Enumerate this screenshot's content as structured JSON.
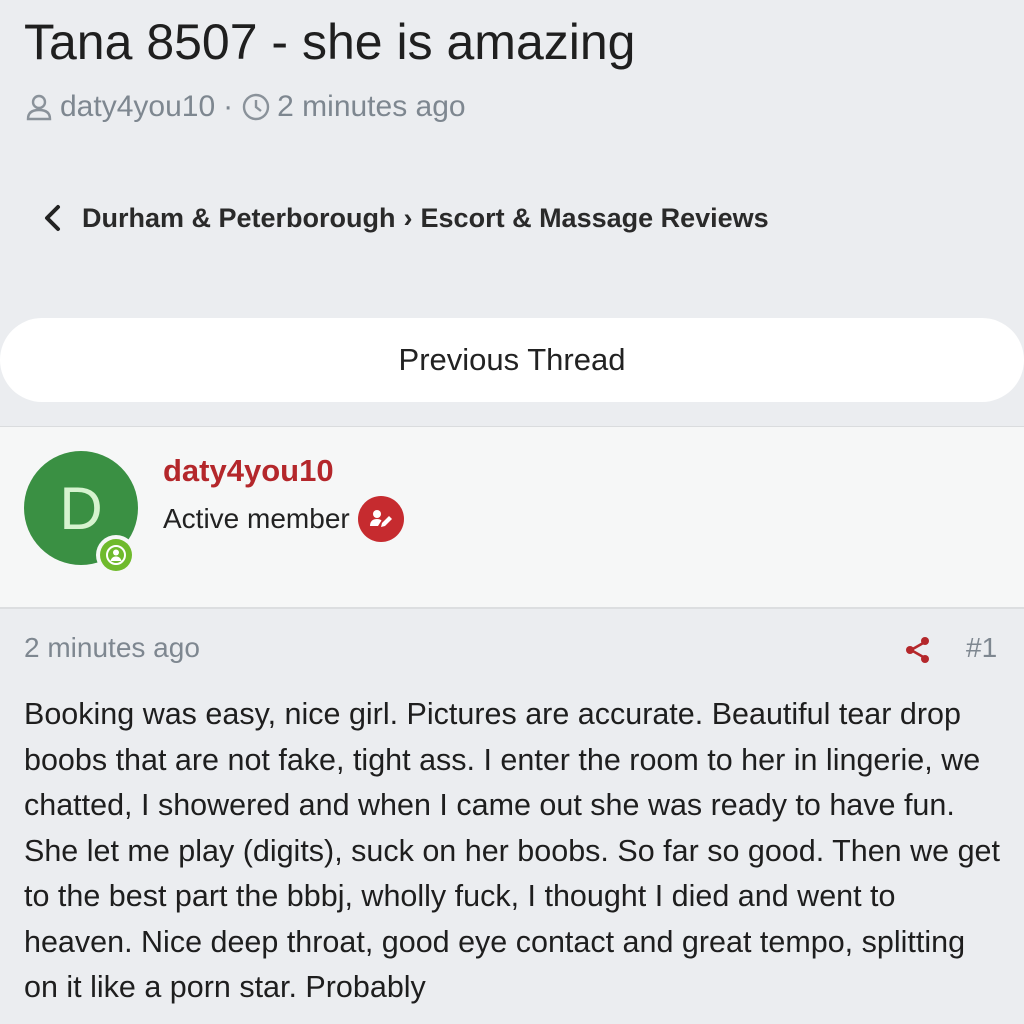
{
  "thread": {
    "title": "Tana 8507 - she is amazing",
    "author": "daty4you10",
    "separator": "·",
    "time": "2 minutes ago"
  },
  "breadcrumb": {
    "parent": "Durham & Peterborough",
    "separator": "›",
    "current": "Escort & Massage Reviews"
  },
  "navigation": {
    "previous_thread_label": "Previous Thread"
  },
  "post": {
    "avatar_letter": "D",
    "author": "daty4you10",
    "role": "Active member",
    "time": "2 minutes ago",
    "number": "#1",
    "body": "Booking was easy, nice girl. Pictures are accurate. Beautiful tear drop boobs that are not fake, tight ass. I enter the room to her in lingerie, we chatted, I showered and when I came out she was ready to have fun. She let me play (digits), suck on her boobs. So far so good. Then we get to the best part the bbbj, wholly fuck, I thought I died and went to heaven. Nice deep throat, good eye contact and great tempo, splitting on it like a porn star. Probably"
  },
  "icons": {
    "user": "user-icon",
    "clock": "clock-icon",
    "back": "chevron-left-icon",
    "online": "online-status-icon",
    "badge": "member-badge-icon",
    "share": "share-icon"
  },
  "colors": {
    "background": "#ebedf0",
    "accent": "#b4272b",
    "avatar": "#3a9043",
    "online": "#6fba2c",
    "muted": "#7e8790"
  }
}
